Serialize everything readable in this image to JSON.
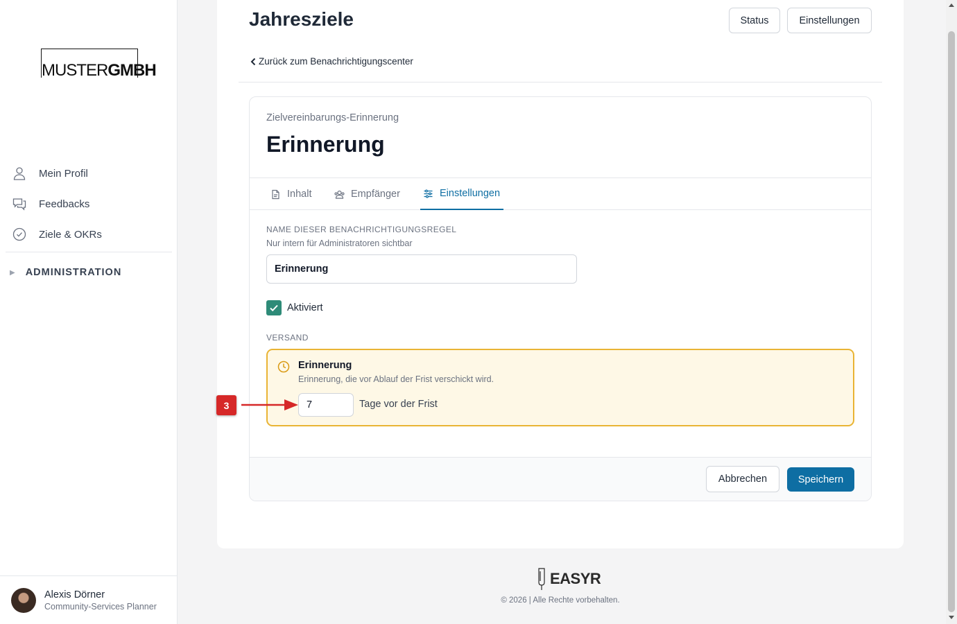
{
  "sidebar": {
    "logo": {
      "light": "MUSTER",
      "bold": "GMBH"
    },
    "items": [
      {
        "label": "Mein Profil",
        "icon": "user-icon"
      },
      {
        "label": "Feedbacks",
        "icon": "chat-icon"
      },
      {
        "label": "Ziele & OKRs",
        "icon": "check-circle-icon"
      }
    ],
    "admin_label": "ADMINISTRATION",
    "user": {
      "name": "Alexis Dörner",
      "role": "Community-Services Planner"
    }
  },
  "header": {
    "title": "Jahresziele",
    "status_btn": "Status",
    "settings_btn": "Einstellungen",
    "back_link": "Zurück zum Benachrichtigungscenter"
  },
  "card": {
    "subtitle": "Zielvereinbarungs-Erinnerung",
    "title": "Erinnerung",
    "tabs": [
      {
        "label": "Inhalt",
        "icon": "document-icon",
        "active": false
      },
      {
        "label": "Empfänger",
        "icon": "users-icon",
        "active": false
      },
      {
        "label": "Einstellungen",
        "icon": "sliders-icon",
        "active": true
      }
    ],
    "name_label": "Name dieser Benachrichtigungsregel",
    "name_hint": "Nur intern für Administratoren sichtbar",
    "name_value": "Erinnerung",
    "activated_label": "Aktiviert",
    "activated": true,
    "versand_label": "Versand",
    "reminder": {
      "title": "Erinnerung",
      "desc": "Erinnerung, die vor Ablauf der Frist verschickt wird.",
      "days_value": "7",
      "days_suffix": "Tage vor der Frist"
    },
    "cancel_btn": "Abbrechen",
    "save_btn": "Speichern"
  },
  "annotation": {
    "badge": "3",
    "color": "#d62828"
  },
  "footer": {
    "brand": "EASYR",
    "copyright": "© 2026 | Alle Rechte vorbehalten."
  },
  "colors": {
    "accent": "#0e6ea3",
    "check": "#2e8b78",
    "highlight_border": "#e9b434",
    "highlight_bg": "#fef8e6"
  }
}
